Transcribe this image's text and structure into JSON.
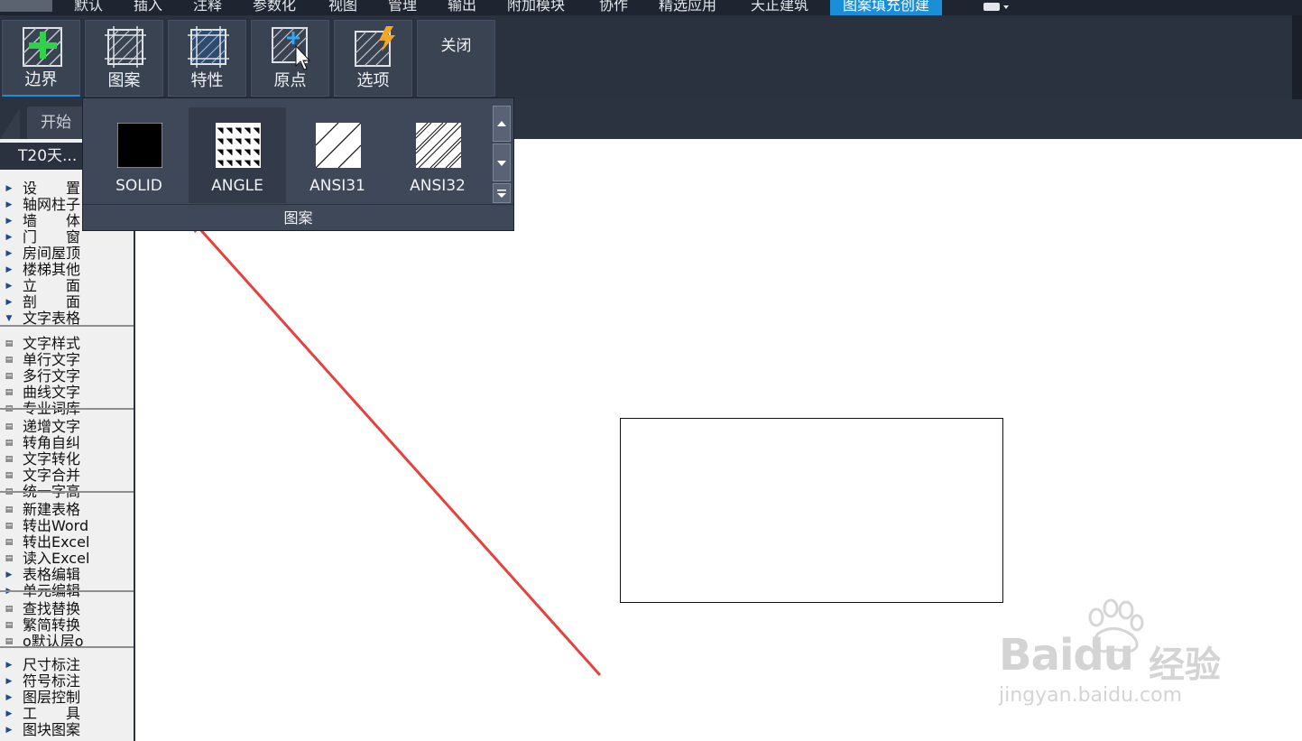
{
  "menubar": {
    "tabs": [
      "默认",
      "插入",
      "注释",
      "参数化",
      "视图",
      "管理",
      "输出",
      "附加模块",
      "协作",
      "精选应用",
      "天正建筑",
      "图案填充创建"
    ],
    "active_tab": "图案填充创建",
    "active_color": "#1a8fd8"
  },
  "ribbon": {
    "buttons": [
      {
        "label": "边界",
        "icon": "boundary-add-icon"
      },
      {
        "label": "图案",
        "icon": "hatch-pattern-icon"
      },
      {
        "label": "特性",
        "icon": "hatch-properties-icon"
      },
      {
        "label": "原点",
        "icon": "hatch-origin-icon"
      },
      {
        "label": "选项",
        "icon": "hatch-options-icon"
      }
    ],
    "close_label": "关闭"
  },
  "doc_tab": {
    "label": "开始"
  },
  "palette": {
    "title": "T20天...",
    "groups": [
      {
        "items": [
          {
            "label": "设　　置",
            "mark": "right-arrow"
          },
          {
            "label": "轴网柱子",
            "mark": "right-arrow"
          },
          {
            "label": "墙　　体",
            "mark": "right-arrow"
          },
          {
            "label": "门　　窗",
            "mark": "right-arrow"
          },
          {
            "label": "房间屋顶",
            "mark": "right-arrow"
          },
          {
            "label": "楼梯其他",
            "mark": "right-arrow"
          },
          {
            "label": "立　　面",
            "mark": "right-arrow"
          },
          {
            "label": "剖　　面",
            "mark": "right-arrow"
          },
          {
            "label": "文字表格",
            "mark": "down-arrow"
          }
        ]
      },
      {
        "items": [
          {
            "label": "文字样式",
            "mark": "text-style-icon"
          },
          {
            "label": "单行文字",
            "mark": "single-text-icon"
          },
          {
            "label": "多行文字",
            "mark": "multi-text-icon"
          },
          {
            "label": "曲线文字",
            "mark": "curve-text-icon"
          },
          {
            "label": "专业词库",
            "mark": "dictionary-icon"
          }
        ]
      },
      {
        "items": [
          {
            "label": "递增文字",
            "mark": "increment-text-icon"
          },
          {
            "label": "转角自纠",
            "mark": "angle-fix-icon"
          },
          {
            "label": "文字转化",
            "mark": "text-convert-icon"
          },
          {
            "label": "文字合并",
            "mark": "text-merge-icon"
          },
          {
            "label": "统一字高",
            "mark": "text-height-icon"
          }
        ]
      },
      {
        "items": [
          {
            "label": "新建表格",
            "mark": "new-table-icon"
          },
          {
            "label": "转出Word",
            "mark": "export-word-icon"
          },
          {
            "label": "转出Excel",
            "mark": "export-excel-icon"
          },
          {
            "label": "读入Excel",
            "mark": "import-excel-icon"
          },
          {
            "label": "表格编辑",
            "mark": "right-arrow"
          },
          {
            "label": "单元编辑",
            "mark": "right-arrow"
          }
        ]
      },
      {
        "items": [
          {
            "label": "查找替换",
            "mark": "find-replace-icon"
          },
          {
            "label": "繁简转换",
            "mark": "gb-big5-icon"
          },
          {
            "label": "o默认层o",
            "mark": "default-layer-icon"
          }
        ]
      },
      {
        "items": [
          {
            "label": "尺寸标注",
            "mark": "right-arrow"
          },
          {
            "label": "符号标注",
            "mark": "right-arrow"
          },
          {
            "label": "图层控制",
            "mark": "right-arrow"
          },
          {
            "label": "工　　具",
            "mark": "right-arrow"
          },
          {
            "label": "图块图案",
            "mark": "right-arrow"
          }
        ]
      }
    ]
  },
  "pattern_panel": {
    "patterns": [
      "SOLID",
      "ANGLE",
      "ANSI31",
      "ANSI32"
    ],
    "selected": "ANGLE",
    "group_title": "图案"
  },
  "watermark": {
    "brand": "Baidu",
    "sub": "经验",
    "url": "jingyan.baidu.com"
  },
  "annotation": {
    "arrow_color": "#e8403c"
  }
}
